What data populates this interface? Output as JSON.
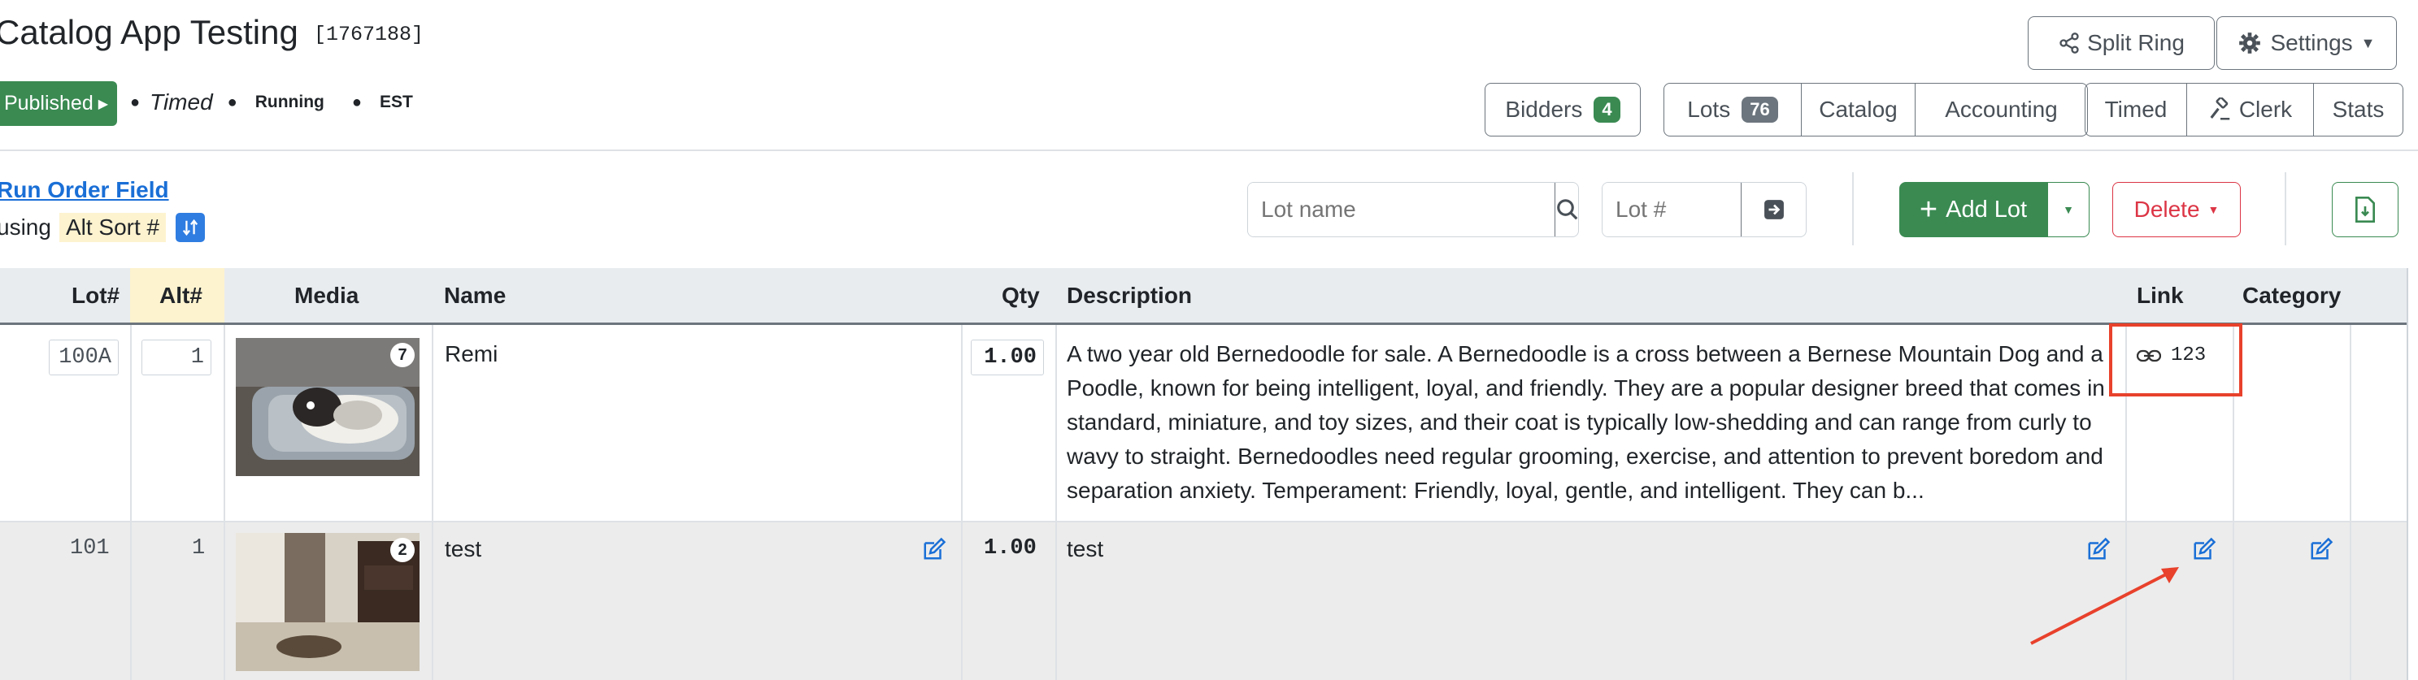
{
  "header": {
    "title": "Catalog App Testing",
    "id": "[1767188]",
    "status_button": "Published",
    "meta": [
      "Timed",
      "Running",
      "EST"
    ],
    "split_ring": "Split Ring",
    "settings": "Settings"
  },
  "nav": {
    "bidders_label": "Bidders",
    "bidders_count": "4",
    "lots_label": "Lots",
    "lots_count": "76",
    "catalog": "Catalog",
    "accounting": "Accounting",
    "timed": "Timed",
    "clerk": "Clerk",
    "stats": "Stats"
  },
  "toolbar": {
    "run_order_link": "Run Order Field",
    "using_label": "using",
    "sort_field": "Alt Sort #",
    "lot_name_placeholder": "Lot name",
    "lot_num_placeholder": "Lot #",
    "add_lot": "Add Lot",
    "delete": "Delete"
  },
  "table": {
    "columns": [
      "Lot#",
      "Alt#",
      "Media",
      "Name",
      "Qty",
      "Description",
      "Link",
      "Category"
    ],
    "rows": [
      {
        "lot": "100A",
        "alt": "1",
        "media_count": "7",
        "name": "Remi",
        "qty": "1.00",
        "description": "A two year old Bernedoodle for sale. A Bernedoodle is a cross between a Bernese Mountain Dog and a Poodle, known for being intelligent, loyal, and friendly. They are a popular designer breed that comes in standard, miniature, and toy sizes, and their coat is typically low-shedding and can range from curly to wavy to straight. Bernedoodles need regular grooming, exercise, and attention to prevent boredom and separation anxiety.  Temperament: Friendly, loyal, gentle, and intelligent. They can b...",
        "link": "123"
      },
      {
        "lot": "101",
        "alt": "1",
        "media_count": "2",
        "name": "test",
        "qty": "1.00",
        "description": "test",
        "link": ""
      }
    ]
  },
  "colors": {
    "green": "#3a8a52",
    "red": "#dc3545",
    "blue_link": "#1a6fd6",
    "highlight": "#fdf3cf",
    "annotation": "#e8412c"
  }
}
